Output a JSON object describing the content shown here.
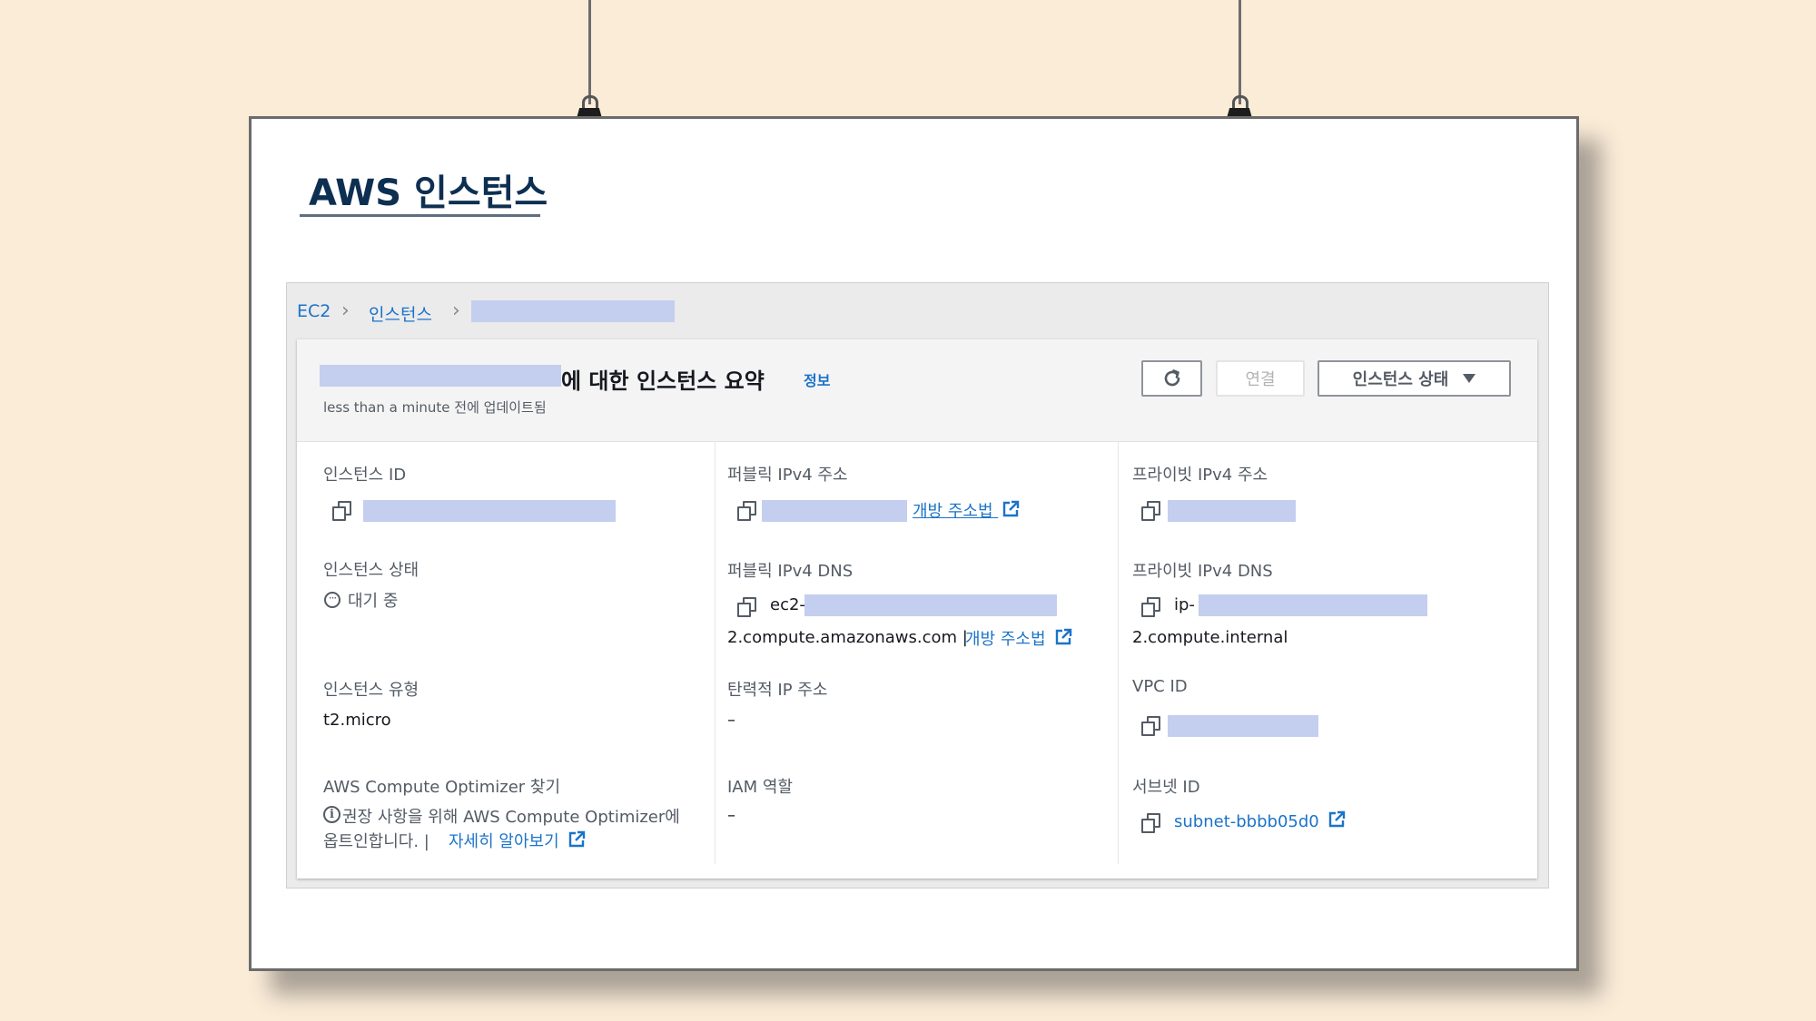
{
  "poster_title": "AWS 인스턴스",
  "breadcrumb": {
    "items": [
      "EC2",
      "인스턴스"
    ]
  },
  "header": {
    "title": "에 대한 인스턴스 요약",
    "info_link": "정보",
    "subtitle": "less than a minute 전에 업데이트됨"
  },
  "actions": {
    "connect_label": "연결",
    "instance_state_label": "인스턴스 상태"
  },
  "fields": {
    "instance_id": {
      "label": "인스턴스 ID"
    },
    "public_ipv4": {
      "label": "퍼블릭 IPv4 주소",
      "link": "개방 주소법"
    },
    "private_ipv4": {
      "label": "프라이빗 IPv4 주소"
    },
    "instance_state": {
      "label": "인스턴스 상태",
      "value": "대기 중"
    },
    "public_dns": {
      "label": "퍼블릭 IPv4 DNS",
      "prefix": "ec2-",
      "value_line2": "2.compute.amazonaws.com |",
      "link": "개방 주소법"
    },
    "private_dns": {
      "label": "프라이빗 IPv4 DNS",
      "prefix": "ip-",
      "value_line2": "2.compute.internal"
    },
    "instance_type": {
      "label": "인스턴스 유형",
      "value": "t2.micro"
    },
    "elastic_ip": {
      "label": "탄력적 IP 주소",
      "value": "–"
    },
    "vpc_id": {
      "label": "VPC ID"
    },
    "optimizer": {
      "label": "AWS Compute Optimizer 찾기",
      "text_line1": "권장 사항을 위해 AWS Compute Optimizer에",
      "text_line2": "옵트인합니다. |",
      "link": "자세히 알아보기"
    },
    "iam_role": {
      "label": "IAM 역할",
      "value": "–"
    },
    "subnet_id": {
      "label": "서브넷 ID",
      "value": "subnet-bbbb05d0"
    }
  },
  "colors": {
    "background": "#fbecd8",
    "title": "#0d2f52",
    "link": "#1b73c9",
    "redaction": "#c4ceef"
  }
}
